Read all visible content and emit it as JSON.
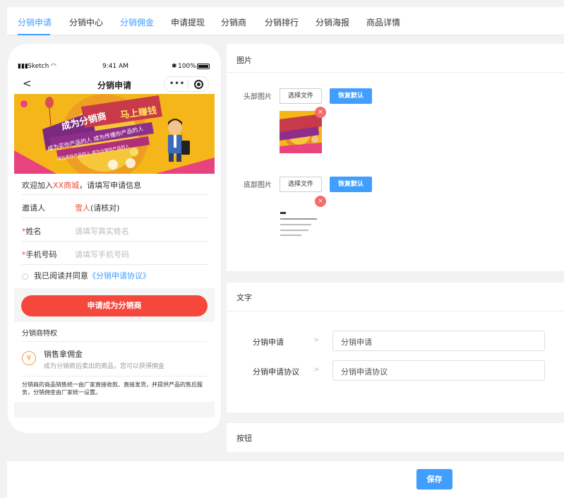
{
  "tabs": [
    {
      "label": "分销申请"
    },
    {
      "label": "分销中心"
    },
    {
      "label": "分销佣金"
    },
    {
      "label": "申请提现"
    },
    {
      "label": "分销商"
    },
    {
      "label": "分销排行"
    },
    {
      "label": "分销海报"
    },
    {
      "label": "商品详情"
    }
  ],
  "colors": {
    "accent": "#409eff",
    "danger": "#f5473c",
    "banner": "#f4b619"
  },
  "phone": {
    "status": {
      "carrier": "Sketch",
      "time": "9:41 AM",
      "battery": "100%"
    },
    "nav_title": "分销申请",
    "banner": {
      "headline1": "成为分销商",
      "headline2": "马上赚钱",
      "ribbon": "成为买你产品的人 成为传播你产品的人",
      "ribbon2": "成为卖你产品的人 成为分销你产品的人"
    },
    "welcome": {
      "prefix": "欢迎加入",
      "shop": "XX商城",
      "suffix": "，请填写申请信息"
    },
    "form": {
      "inviter_label": "邀请人",
      "inviter_name": "雪人",
      "inviter_note": "(请核对)",
      "name_label": "姓名",
      "name_placeholder": "请填写真实姓名",
      "phone_label": "手机号码",
      "phone_placeholder": "请填写手机号码",
      "required_mark": "*"
    },
    "agree": {
      "text": "我已阅读并同意",
      "link": "《分销申请协议》"
    },
    "apply_button": "申请成为分销商",
    "privilege": {
      "title": "分销商特权",
      "icon": "¥",
      "name": "销售拿佣金",
      "desc": "成为分销商后卖出的商品，您可以获得佣金",
      "note": "分销商的商品销售统一由厂家直接收款、直接发货，并提供产品的售后服务，分销佣金由厂家统一设置。"
    }
  },
  "image_section": {
    "title": "图片",
    "header_label": "头部图片",
    "footer_label": "底部图片",
    "choose_file": "选择文件",
    "reset_default": "恢复默认",
    "remove_icon": "×"
  },
  "text_section": {
    "title": "文字",
    "fields": [
      {
        "label": "分销申请",
        "value": "分销申请"
      },
      {
        "label": "分销申请协议",
        "value": "分销申请协议"
      }
    ]
  },
  "button_section": {
    "title": "按钮"
  },
  "save_button": "保存"
}
